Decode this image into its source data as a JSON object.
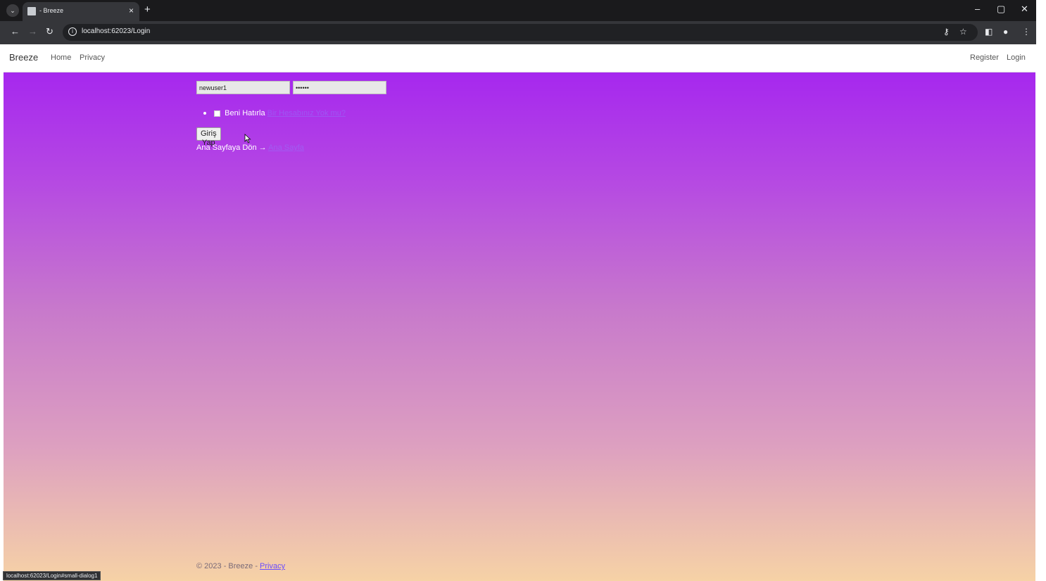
{
  "browser": {
    "tab_title": "- Breeze",
    "tab_close": "×",
    "new_tab": "+",
    "url": "localhost:62023/Login",
    "window_minimize": "–",
    "window_maximize": "▢",
    "window_close": "✕",
    "status_url": "localhost:62023/Login#small-dialog1"
  },
  "navbar": {
    "brand": "Breeze",
    "links": [
      "Home",
      "Privacy"
    ],
    "right_links": [
      "Register",
      "Login"
    ]
  },
  "login": {
    "username_value": "newuser1",
    "password_value": "••••••",
    "remember_label": "Beni Hatırla",
    "signup_link": "Bir Hesabınız Yok mu?",
    "submit_label": "Giriş Yap",
    "back_text": "Ana Sayfaya Dön →",
    "back_link": "Ana Sayfa"
  },
  "footer": {
    "text": "© 2023 - Breeze - ",
    "privacy_link": "Privacy"
  },
  "colors": {
    "gradient_top": "#a21ff1",
    "gradient_bottom": "#f6d2a6",
    "link": "#6a4cff"
  }
}
